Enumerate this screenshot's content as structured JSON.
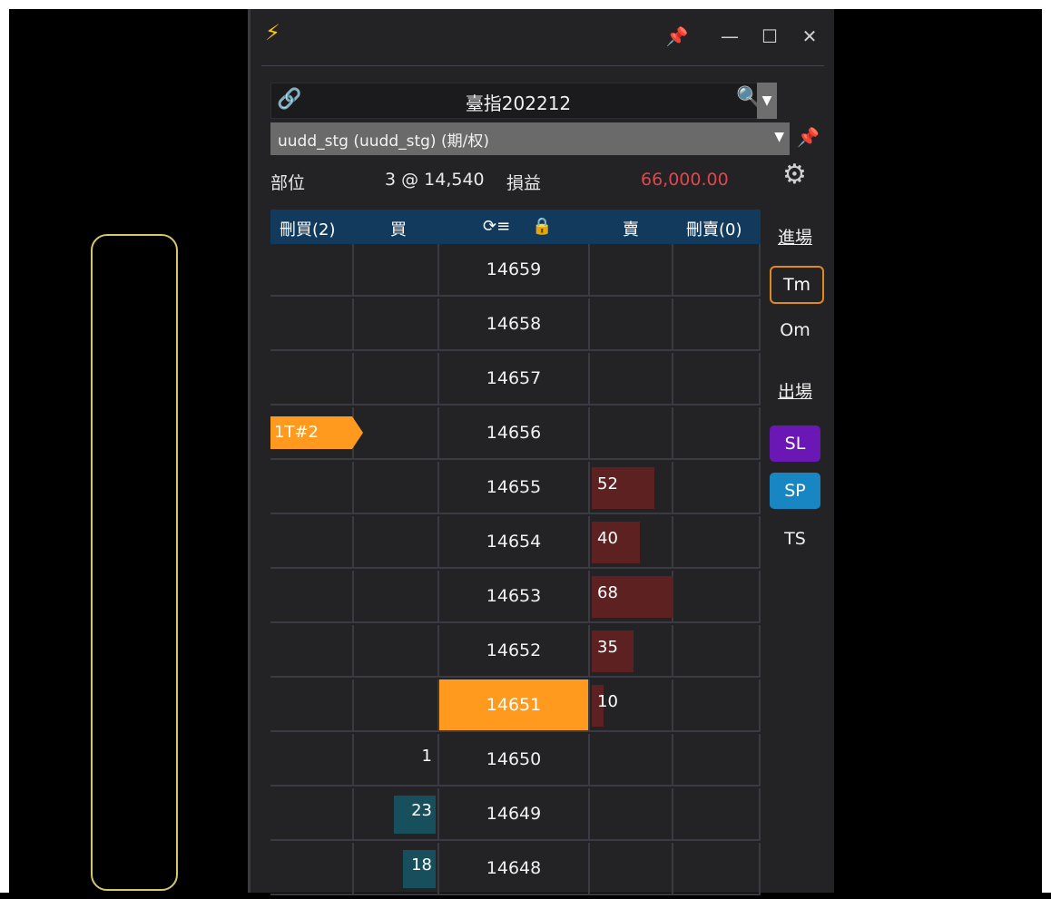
{
  "window": {
    "app_icon": "⚡",
    "controls": {
      "pin": "📌",
      "minimize": "—",
      "maximize": "☐",
      "close": "✕"
    }
  },
  "symbol": {
    "link_icon": "🔗",
    "name": "臺指202212",
    "search_icon": "🔍",
    "dropdown": "▼"
  },
  "strategy": {
    "label": "uudd_stg (uudd_stg) (期/权)",
    "dropdown": "▼",
    "pin": "📌"
  },
  "position": {
    "label": "部位",
    "value": "3 @ 14,540",
    "pnl_label": "損益",
    "pnl_value": "66,000.00",
    "settings_icon": "⚙"
  },
  "ladder": {
    "headers": {
      "del_buy": "刪買(2)",
      "buy": "買",
      "center_icon": "⟳≡",
      "lock_icon": "🔒",
      "sell": "賣",
      "del_sell": "刪賣(0)"
    },
    "rows": [
      {
        "price": "14659",
        "bid": "",
        "ask": "",
        "order": ""
      },
      {
        "price": "14658",
        "bid": "",
        "ask": "",
        "order": ""
      },
      {
        "price": "14657",
        "bid": "",
        "ask": "",
        "order": ""
      },
      {
        "price": "14656",
        "bid": "",
        "ask": "",
        "order": "1T#2"
      },
      {
        "price": "14655",
        "bid": "",
        "ask": "52",
        "order": ""
      },
      {
        "price": "14654",
        "bid": "",
        "ask": "40",
        "order": ""
      },
      {
        "price": "14653",
        "bid": "",
        "ask": "68",
        "order": ""
      },
      {
        "price": "14652",
        "bid": "",
        "ask": "35",
        "order": ""
      },
      {
        "price": "14651",
        "bid": "",
        "ask": "10",
        "order": "",
        "current": true
      },
      {
        "price": "14650",
        "bid": "1",
        "ask": "",
        "order": ""
      },
      {
        "price": "14649",
        "bid": "23",
        "ask": "",
        "order": ""
      },
      {
        "price": "14648",
        "bid": "18",
        "ask": "",
        "order": ""
      }
    ]
  },
  "side": {
    "entry_label": "進場",
    "tm": "Tm",
    "om": "Om",
    "exit_label": "出場",
    "sl": "SL",
    "sp": "SP",
    "ts": "TS"
  },
  "colors": {
    "accent": "#ff9a1f",
    "ask_bar": "#5e2121",
    "bid_bar": "#17505c",
    "header": "#123a5c",
    "pnl": "#e0464b"
  }
}
